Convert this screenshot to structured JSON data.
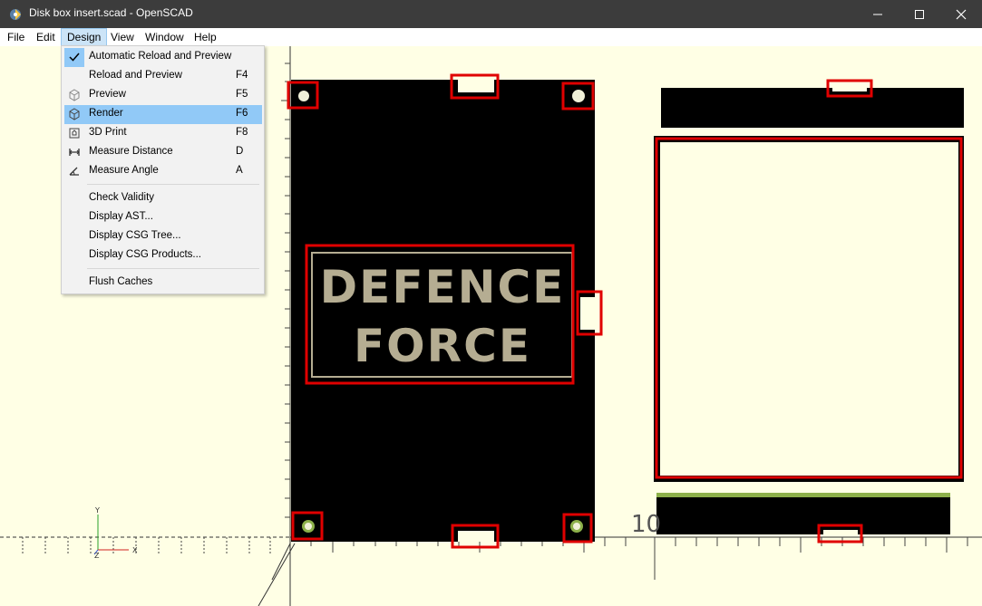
{
  "window": {
    "title": "Disk box insert.scad - OpenSCAD",
    "icon": "openscad-icon",
    "controls": [
      "minimize-icon",
      "maximize-icon",
      "close-icon"
    ]
  },
  "menubar": {
    "items": [
      {
        "label": "File"
      },
      {
        "label": "Edit"
      },
      {
        "label": "Design",
        "open": true
      },
      {
        "label": "View"
      },
      {
        "label": "Window"
      },
      {
        "label": "Help"
      }
    ]
  },
  "design_menu": {
    "items": [
      {
        "label": "Automatic Reload and Preview",
        "shortcut": "",
        "checked": true,
        "icon": "checkmark-icon"
      },
      {
        "label": "Reload and Preview",
        "shortcut": "F4"
      },
      {
        "label": "Preview",
        "shortcut": "F5",
        "icon": "preview-icon"
      },
      {
        "label": "Render",
        "shortcut": "F6",
        "icon": "render-icon",
        "highlighted": true
      },
      {
        "label": "3D Print",
        "shortcut": "F8",
        "icon": "3d-print-icon"
      },
      {
        "label": "Measure Distance",
        "shortcut": "D",
        "icon": "measure-distance-icon"
      },
      {
        "label": "Measure Angle",
        "shortcut": "A",
        "icon": "measure-angle-icon"
      },
      {
        "label": "Check Validity",
        "shortcut": ""
      },
      {
        "label": "Display AST...",
        "shortcut": ""
      },
      {
        "label": "Display CSG Tree...",
        "shortcut": ""
      },
      {
        "label": "Display CSG Products...",
        "shortcut": ""
      },
      {
        "label": "Flush Caches",
        "shortcut": ""
      }
    ]
  },
  "viewport": {
    "model_text_line1": "DEFENCE",
    "model_text_line2": "FORCE",
    "ruler_number": "10",
    "axis_labels": {
      "x": "X",
      "y": "Y",
      "z": "Z"
    },
    "colors": {
      "background": "#ffffe5",
      "model": "#000000",
      "highlight": "#e00000",
      "text": "#b5ad92",
      "green": "#8db04a"
    }
  }
}
